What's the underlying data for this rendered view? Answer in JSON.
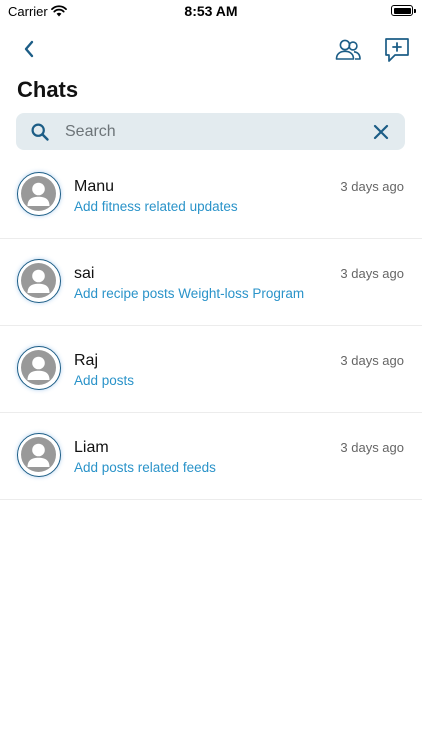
{
  "status_bar": {
    "carrier": "Carrier",
    "time": "8:53 AM"
  },
  "header": {
    "title": "Chats"
  },
  "search": {
    "placeholder": "Search",
    "value": ""
  },
  "chats": [
    {
      "name": "Manu",
      "preview": "Add fitness related updates",
      "time": "3 days ago"
    },
    {
      "name": "sai",
      "preview": "Add recipe posts Weight-loss Program",
      "time": "3 days ago"
    },
    {
      "name": "Raj",
      "preview": "Add posts",
      "time": "3 days ago"
    },
    {
      "name": "Liam",
      "preview": "Add posts related feeds",
      "time": "3 days ago"
    }
  ],
  "colors": {
    "accent": "#1c5d86",
    "preview_text": "#2a93c9",
    "search_bg": "#e3ebef",
    "avatar_placeholder": "#999999"
  },
  "icons": {
    "back": "chevron-left-icon",
    "group": "people-icon",
    "new_chat": "chat-plus-icon",
    "search": "search-icon",
    "clear": "close-icon",
    "avatar": "person-icon"
  }
}
